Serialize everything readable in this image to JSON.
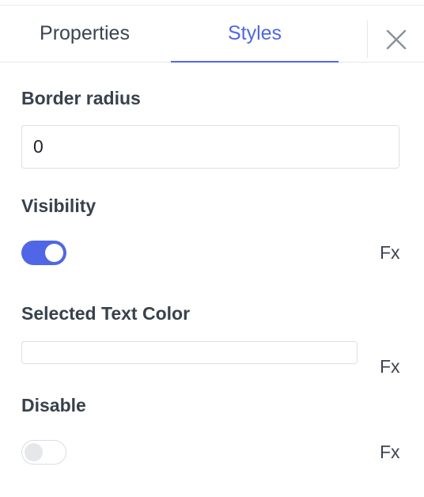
{
  "tabs": {
    "properties": "Properties",
    "styles": "Styles",
    "active": "styles"
  },
  "fields": {
    "border_radius": {
      "label": "Border radius",
      "value": "0"
    },
    "visibility": {
      "label": "Visibility",
      "enabled": true,
      "fx": "Fx"
    },
    "selected_text_color": {
      "label": "Selected Text Color",
      "value": "",
      "fx": "Fx"
    },
    "disable": {
      "label": "Disable",
      "enabled": false,
      "fx": "Fx"
    }
  },
  "icons": {
    "close": "close-icon"
  },
  "colors": {
    "accent": "#4f67e6",
    "text": "#38414c"
  }
}
